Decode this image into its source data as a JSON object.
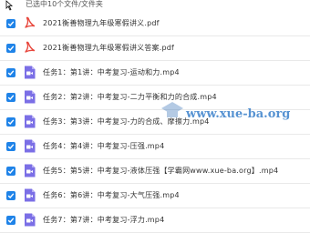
{
  "header": {
    "summary": "已选中10个文件/文件夹"
  },
  "files": [
    {
      "type": "pdf",
      "name": "2021衡善物理九年级寒假讲义.pdf"
    },
    {
      "type": "pdf",
      "name": "2021衡善物理九年级寒假讲义答案.pdf"
    },
    {
      "type": "video",
      "name": "任务1：第1讲：中考复习-运动和力.mp4"
    },
    {
      "type": "video",
      "name": "任务2：第2讲：中考复习-二力平衡和力的合成.mp4"
    },
    {
      "type": "video",
      "name": "任务3：第3讲：中考复习-力的合成、摩擦力.mp4"
    },
    {
      "type": "video",
      "name": "任务4：第4讲：中考复习-压强.mp4"
    },
    {
      "type": "video",
      "name": "任务5：第5讲：中考复习-液体压强【学霸网www.xue-ba.org】.mp4"
    },
    {
      "type": "video",
      "name": "任务6：第6讲：中考复习-大气压强.mp4"
    },
    {
      "type": "video",
      "name": "任务7：第7讲：中考复习-浮力.mp4"
    }
  ],
  "watermark": {
    "text": "www.xue-ba.org"
  },
  "colors": {
    "checkbox": "#1f83e8",
    "pdf": "#e8493f",
    "video": "#7b6fe6"
  }
}
